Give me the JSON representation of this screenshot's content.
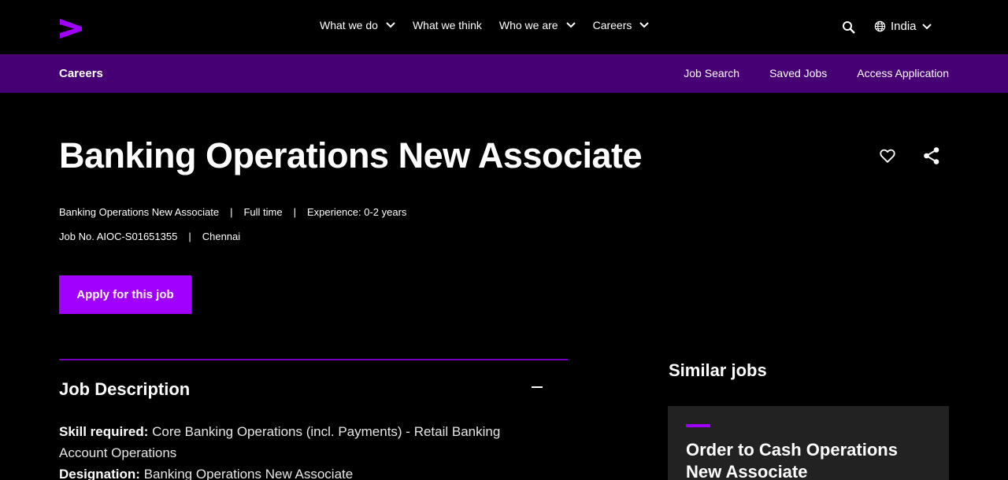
{
  "colors": {
    "accent": "#a100ff",
    "subnav_bg": "#460073",
    "divider": "#7500c0",
    "card_bg": "#222222"
  },
  "topnav": {
    "logo_icon": "accenture-chevron-logo",
    "menu": [
      {
        "label": "What we do",
        "has_dropdown": true
      },
      {
        "label": "What we think",
        "has_dropdown": false
      },
      {
        "label": "Who we are",
        "has_dropdown": true
      },
      {
        "label": "Careers",
        "has_dropdown": true
      }
    ],
    "search_icon": "search-icon",
    "locale": "India"
  },
  "subnav": {
    "brand": "Careers",
    "links": [
      "Job Search",
      "Saved Jobs",
      "Access Application"
    ]
  },
  "job": {
    "title": "Banking Operations New Associate",
    "meta_line1": [
      "Banking Operations New Associate",
      "Full time",
      "Experience: 0-2 years"
    ],
    "meta_line2": [
      "Job No. AIOC-S01651355",
      "Chennai"
    ],
    "separator": "|",
    "apply_label": "Apply for this job"
  },
  "description": {
    "heading": "Job Description",
    "skill_label": "Skill required:",
    "skill_value": "Core Banking Operations (incl. Payments) - Retail Banking Account Operations",
    "designation_label": "Designation:",
    "designation_value": "Banking Operations New Associate"
  },
  "similar": {
    "heading": "Similar jobs",
    "cards": [
      {
        "title": "Order to Cash Operations New Associate"
      }
    ]
  }
}
